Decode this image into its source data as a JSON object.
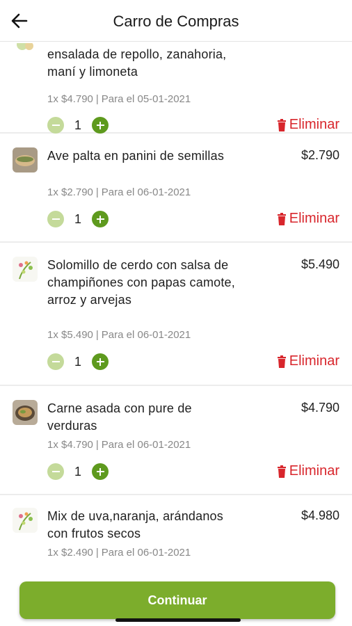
{
  "header": {
    "title": "Carro de Compras"
  },
  "items": [
    {
      "name": "ensalada de repollo, zanahoria, maní y limoneta",
      "price": "",
      "meta_qty_price": "1x $4.790",
      "meta_date": "Para el 05-01-2021",
      "quantity": "1",
      "delete_label": "Eliminar",
      "thumb": "salad-thumb"
    },
    {
      "name": "Ave palta en panini de semillas",
      "price": "$2.790",
      "meta_qty_price": "1x $2.790",
      "meta_date": "Para el 06-01-2021",
      "quantity": "1",
      "delete_label": "Eliminar",
      "thumb": "panini-thumb"
    },
    {
      "name": "Solomillo de cerdo con salsa de champiñones con papas camote, arroz y arvejas",
      "price": "$5.490",
      "meta_qty_price": "1x $5.490",
      "meta_date": "Para el 06-01-2021",
      "quantity": "1",
      "delete_label": "Eliminar",
      "thumb": "leaf-logo-thumb"
    },
    {
      "name": "Carne asada con pure de verduras",
      "price": "$4.790",
      "meta_qty_price": "1x $4.790",
      "meta_date": "Para el 06-01-2021",
      "quantity": "1",
      "delete_label": "Eliminar",
      "thumb": "bowl-thumb"
    },
    {
      "name": "Mix de uva,naranja, arándanos con frutos secos",
      "price": "$4.980",
      "meta_qty_price": "1x $2.490",
      "meta_date": "Para el 06-01-2021",
      "quantity": "",
      "delete_label": "",
      "thumb": "leaf-logo-thumb"
    }
  ],
  "footer": {
    "continue_label": "Continuar"
  },
  "colors": {
    "accent_green": "#7cad2c",
    "plus_green": "#5e9a1e",
    "minus_green": "#c4da9a",
    "delete_red": "#d8262c"
  }
}
